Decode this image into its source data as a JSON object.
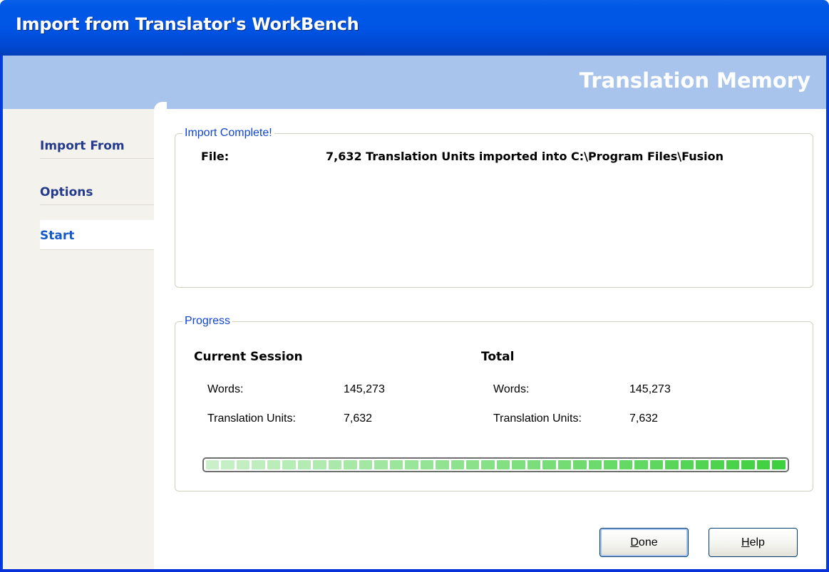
{
  "window": {
    "title": "Import from Translator's WorkBench"
  },
  "banner": {
    "title": "Translation Memory"
  },
  "sidebar": {
    "items": [
      {
        "label": "Import From",
        "active": false
      },
      {
        "label": "Options",
        "active": false
      },
      {
        "label": "Start",
        "active": true
      }
    ]
  },
  "import_group": {
    "legend": "Import Complete!",
    "file_label": "File:",
    "file_value": "7,632 Translation Units imported into C:\\Program Files\\Fusion"
  },
  "progress_group": {
    "legend": "Progress",
    "current_session": {
      "heading": "Current Session",
      "words_label": "Words:",
      "words_value": "145,273",
      "units_label": "Translation Units:",
      "units_value": "7,632"
    },
    "total": {
      "heading": "Total",
      "words_label": "Words:",
      "words_value": "145,273",
      "units_label": "Translation Units:",
      "units_value": "7,632"
    },
    "progress_fraction": 1.0,
    "segment_count": 38
  },
  "buttons": {
    "done": {
      "mnemonic": "D",
      "rest": "one"
    },
    "help": {
      "mnemonic": "H",
      "rest": "elp"
    }
  },
  "colors": {
    "titlebar": "#0055e5",
    "banner": "#a9c4ec",
    "legend": "#1046d0",
    "nav_text": "#243a8c",
    "nav_active": "#1659c8",
    "progress_light": "#c9f0c9",
    "progress_dark": "#3fd03f"
  }
}
